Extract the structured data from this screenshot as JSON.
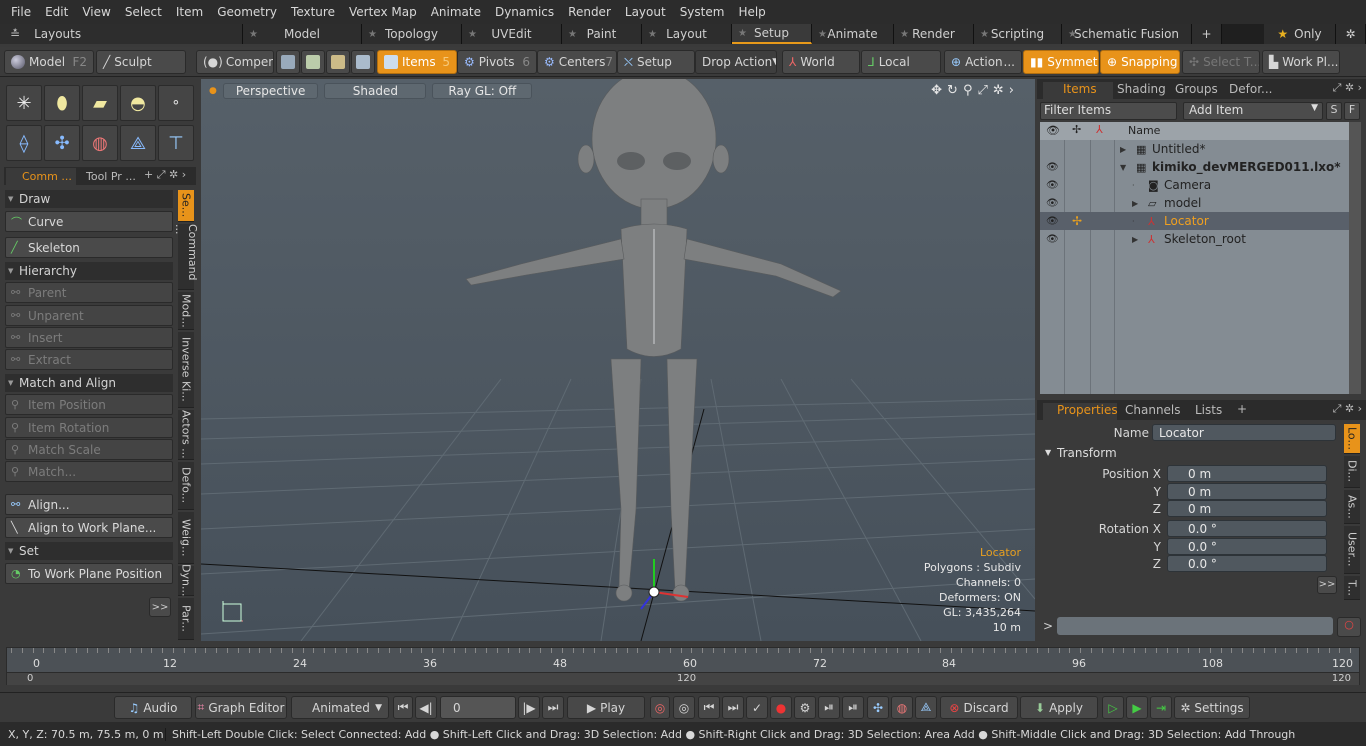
{
  "menu": [
    "File",
    "Edit",
    "View",
    "Select",
    "Item",
    "Geometry",
    "Texture",
    "Vertex Map",
    "Animate",
    "Dynamics",
    "Render",
    "Layout",
    "System",
    "Help"
  ],
  "layouts_label": "Layouts",
  "tabs": [
    {
      "label": "Model",
      "active": false
    },
    {
      "label": "Topology",
      "active": false
    },
    {
      "label": "UVEdit",
      "active": false
    },
    {
      "label": "Paint",
      "active": false
    },
    {
      "label": "Layout",
      "active": false
    },
    {
      "label": "Setup",
      "active": true
    },
    {
      "label": "Animate",
      "active": false
    },
    {
      "label": "Render",
      "active": false
    },
    {
      "label": "Scripting",
      "active": false
    },
    {
      "label": "Schematic Fusion",
      "active": false
    }
  ],
  "add_tab": "+",
  "only_label": "Only",
  "toolbar": {
    "model": "Model",
    "model_key": "F2",
    "sculpt": "Sculpt",
    "components": "Compen...",
    "items": "Items",
    "items_num": "5",
    "pivots": "Pivots",
    "pivots_num": "6",
    "centers": "Centers",
    "centers_num": "7",
    "setup": "Setup",
    "drop_action": "Drop Action",
    "world": "World",
    "local": "Local",
    "action": "Action",
    "action_more": "...",
    "symmetry": "Symmet...",
    "snapping": "Snapping",
    "select_t": "Select T...",
    "work_plane": "Work Pl..."
  },
  "left": {
    "tab1": "Comm ...",
    "tab2": "Tool Pr ...",
    "sections": {
      "draw": "Draw",
      "hierarchy": "Hierarchy",
      "match_align": "Match and Align",
      "set": "Set"
    },
    "buttons": {
      "curve": "Curve",
      "skeleton": "Skeleton",
      "parent": "Parent",
      "unparent": "Unparent",
      "insert": "Insert",
      "extract": "Extract",
      "item_position": "Item Position",
      "item_rotation": "Item Rotation",
      "match_scale": "Match Scale",
      "match": "Match...",
      "align": "Align...",
      "align_work_plane": "Align to Work Plane...",
      "to_work_plane_position": "To Work Plane Position",
      "more": ">>"
    },
    "vtabs": [
      "Se...",
      "Command ...",
      "Mod...",
      "Inverse Ki...",
      "Actors ...",
      "Defo...",
      "Weig...",
      "Dyn...",
      "Par..."
    ]
  },
  "viewport": {
    "perspective": "Perspective",
    "shaded": "Shaded",
    "raygl": "Ray GL: Off",
    "info": {
      "item": "Locator",
      "polygons": "Polygons : Subdiv",
      "channels": "Channels: 0",
      "deformers": "Deformers: ON",
      "gl": "GL: 3,435,264",
      "scale": "10 m"
    }
  },
  "items_panel": {
    "tabs": [
      "Items",
      "Shading",
      "Groups",
      "Defor..."
    ],
    "filter_placeholder": "Filter Items",
    "add_item": "Add Item",
    "btn_s": "S",
    "btn_f": "F",
    "col_name": "Name",
    "rows": [
      {
        "label": "Untitled*",
        "indent": 0,
        "bold": false,
        "eye": false,
        "selected": false
      },
      {
        "label": "kimiko_devMERGED011.lxo*",
        "indent": 0,
        "bold": true,
        "eye": true,
        "selected": false
      },
      {
        "label": "Camera",
        "indent": 1,
        "bold": false,
        "eye": true,
        "selected": false
      },
      {
        "label": "model",
        "indent": 1,
        "bold": false,
        "eye": true,
        "selected": false
      },
      {
        "label": "Locator",
        "indent": 1,
        "bold": false,
        "eye": true,
        "selected": true
      },
      {
        "label": "Skeleton_root",
        "indent": 1,
        "bold": false,
        "eye": true,
        "selected": false
      }
    ]
  },
  "properties": {
    "tabs": [
      "Properties",
      "Channels",
      "Lists"
    ],
    "name_label": "Name",
    "name_value": "Locator",
    "transform": "Transform",
    "position_x_label": "Position X",
    "y_label": "Y",
    "z_label": "Z",
    "rotation_x_label": "Rotation X",
    "pos_x": "0 m",
    "pos_y": "0 m",
    "pos_z": "0 m",
    "rot_x": "0.0 °",
    "rot_y": "0.0 °",
    "rot_z": "0.0 °",
    "more": ">>",
    "vtabs": [
      "Lo...",
      "Di...",
      "As...",
      "User...",
      "T..."
    ]
  },
  "timeline": {
    "ticks": [
      "0",
      "12",
      "24",
      "36",
      "48",
      "60",
      "72",
      "84",
      "96",
      "108",
      "120"
    ],
    "start": "0",
    "mid": "120",
    "end": "120"
  },
  "bottom": {
    "audio": "Audio",
    "graph_editor": "Graph Editor",
    "animated": "Animated",
    "frame": "0",
    "play": "Play",
    "discard": "Discard",
    "apply": "Apply",
    "settings": "Settings"
  },
  "status": {
    "coords": "X, Y, Z:  70.5 m, 75.5 m, 0 m",
    "hints": "Shift-Left Double Click: Select Connected: Add ● Shift-Left Click and Drag: 3D Selection: Add ● Shift-Right Click and Drag: 3D Selection: Area Add ● Shift-Middle Click and Drag: 3D Selection: Add Through"
  }
}
